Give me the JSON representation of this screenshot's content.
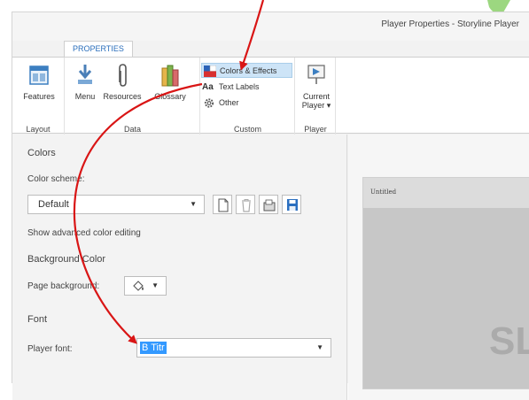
{
  "window": {
    "title": "Player Properties - Storyline Player"
  },
  "tabs": [
    {
      "label": "PROPERTIES"
    }
  ],
  "ribbon": {
    "groups": [
      {
        "label": "Layout",
        "buttons": [
          {
            "label": "Features",
            "icon": "features-icon"
          }
        ]
      },
      {
        "label": "Data",
        "buttons": [
          {
            "label": "Menu",
            "icon": "menu-icon"
          },
          {
            "label": "Resources",
            "icon": "paperclip-icon"
          },
          {
            "label": "Glossary",
            "icon": "glossary-icon"
          }
        ]
      },
      {
        "label": "Custom",
        "buttons": [
          {
            "label": "Colors & Effects",
            "icon": "colors-effects-icon",
            "active": true
          },
          {
            "label": "Text Labels",
            "icon_text": "Aa"
          },
          {
            "label": "Other",
            "icon": "gear-icon"
          }
        ]
      },
      {
        "label": "Player",
        "buttons": [
          {
            "label": "Current",
            "label2": "Player ▾",
            "icon": "current-player-icon"
          }
        ]
      }
    ]
  },
  "panel": {
    "colors_heading": "Colors",
    "color_scheme_label": "Color scheme:",
    "color_scheme_value": "Default",
    "advanced_link": "Show advanced color editing",
    "background_heading": "Background Color",
    "page_background_label": "Page background:",
    "font_heading": "Font",
    "player_font_label": "Player font:",
    "player_font_value": "B Titr"
  },
  "preview": {
    "slide_title": "Untitled",
    "slide_text": "SL"
  },
  "colors": {
    "accent": "#2a6ebb",
    "arrow": "#d91515",
    "highlight": "#3399ff"
  }
}
